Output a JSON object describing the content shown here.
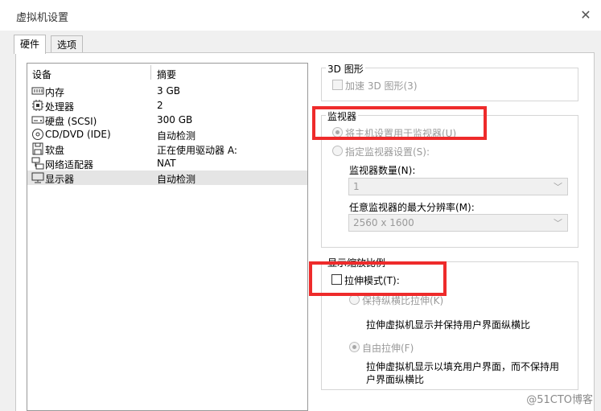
{
  "window": {
    "title": "虚拟机设置"
  },
  "tabs": [
    {
      "label": "硬件"
    },
    {
      "label": "选项"
    }
  ],
  "device_list": {
    "headers": {
      "device": "设备",
      "summary": "摘要"
    },
    "rows": [
      {
        "icon": "memory-icon",
        "name": "内存",
        "summary": "3 GB"
      },
      {
        "icon": "cpu-icon",
        "name": "处理器",
        "summary": "2"
      },
      {
        "icon": "harddisk-icon",
        "name": "硬盘 (SCSI)",
        "summary": "300 GB"
      },
      {
        "icon": "cd-icon",
        "name": "CD/DVD (IDE)",
        "summary": "自动检测"
      },
      {
        "icon": "floppy-icon",
        "name": "软盘",
        "summary": "正在使用驱动器 A:"
      },
      {
        "icon": "network-icon",
        "name": "网络适配器",
        "summary": "NAT"
      },
      {
        "icon": "monitor-icon",
        "name": "显示器",
        "summary": "自动检测"
      }
    ]
  },
  "graphics_3d": {
    "title": "3D 图形",
    "accelerate_label": "加速 3D 图形(3)"
  },
  "monitor": {
    "title": "监视器",
    "use_host_label": "将主机设置用于监视器(U)",
    "specify_label": "指定监视器设置(S):",
    "count_label": "监视器数量(N):",
    "count_value": "1",
    "max_res_label": "任意监视器的最大分辨率(M):",
    "max_res_value": "2560 x 1600"
  },
  "scaling": {
    "title": "显示缩放比例",
    "stretch_label": "拉伸模式(T):",
    "keep_aspect_label": "保持纵横比拉伸(K)",
    "keep_aspect_desc": "拉伸虚拟机显示并保持用户界面纵横比",
    "free_stretch_label": "自由拉伸(F)",
    "free_stretch_desc_1": "拉伸虚拟机显示以填充用户界面，而不保持用",
    "free_stretch_desc_2": "户界面纵横比"
  },
  "watermark": "@51CTO博客",
  "colors": {
    "highlight_box": "#ee2b2b",
    "selected_row": "#e5e5e5"
  }
}
